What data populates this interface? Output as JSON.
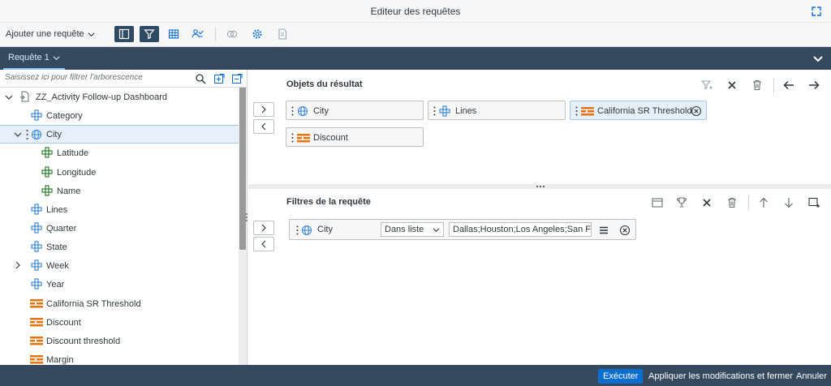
{
  "window": {
    "title": "Editeur des requêtes"
  },
  "toolbar": {
    "add_query_label": "Ajouter une requête"
  },
  "tabs": [
    {
      "label": "Requête 1"
    }
  ],
  "search": {
    "placeholder": "Saisissez ici pour filtrer l'arborescence"
  },
  "tree": {
    "root": "ZZ_Activity Follow-up Dashboard",
    "items": [
      {
        "label": "Category",
        "type": "dimension"
      },
      {
        "label": "City",
        "type": "geo"
      },
      {
        "label": "Latitude",
        "type": "attribute"
      },
      {
        "label": "Longitude",
        "type": "attribute"
      },
      {
        "label": "Name",
        "type": "attribute"
      },
      {
        "label": "Lines",
        "type": "dimension"
      },
      {
        "label": "Quarter",
        "type": "dimension"
      },
      {
        "label": "State",
        "type": "dimension"
      },
      {
        "label": "Week",
        "type": "dimension"
      },
      {
        "label": "Year",
        "type": "dimension"
      },
      {
        "label": "California SR Threshold",
        "type": "measure"
      },
      {
        "label": "Discount",
        "type": "measure"
      },
      {
        "label": "Discount threshold",
        "type": "measure"
      },
      {
        "label": "Margin",
        "type": "measure"
      }
    ]
  },
  "results": {
    "title": "Objets du résultat",
    "objects": [
      {
        "label": "City",
        "type": "geo"
      },
      {
        "label": "Lines",
        "type": "dimension"
      },
      {
        "label": "California SR Threshold",
        "type": "measure"
      },
      {
        "label": "Discount",
        "type": "measure"
      }
    ]
  },
  "filters": {
    "title": "Filtres de la requête",
    "rows": [
      {
        "object": "City",
        "operator": "Dans liste",
        "value": "Dallas;Houston;Los Angeles;San Fra"
      }
    ]
  },
  "footer": {
    "run_label": "Exécuter",
    "apply_label": "Appliquer les modifications et fermer",
    "cancel_label": "Annuler"
  },
  "colors": {
    "shell": "#354a5f",
    "accent": "#0a6ed1",
    "dimension_icon": "#3f8ad2",
    "attribute_icon": "#2b7d2b",
    "measure_icon": "#e9730c"
  }
}
